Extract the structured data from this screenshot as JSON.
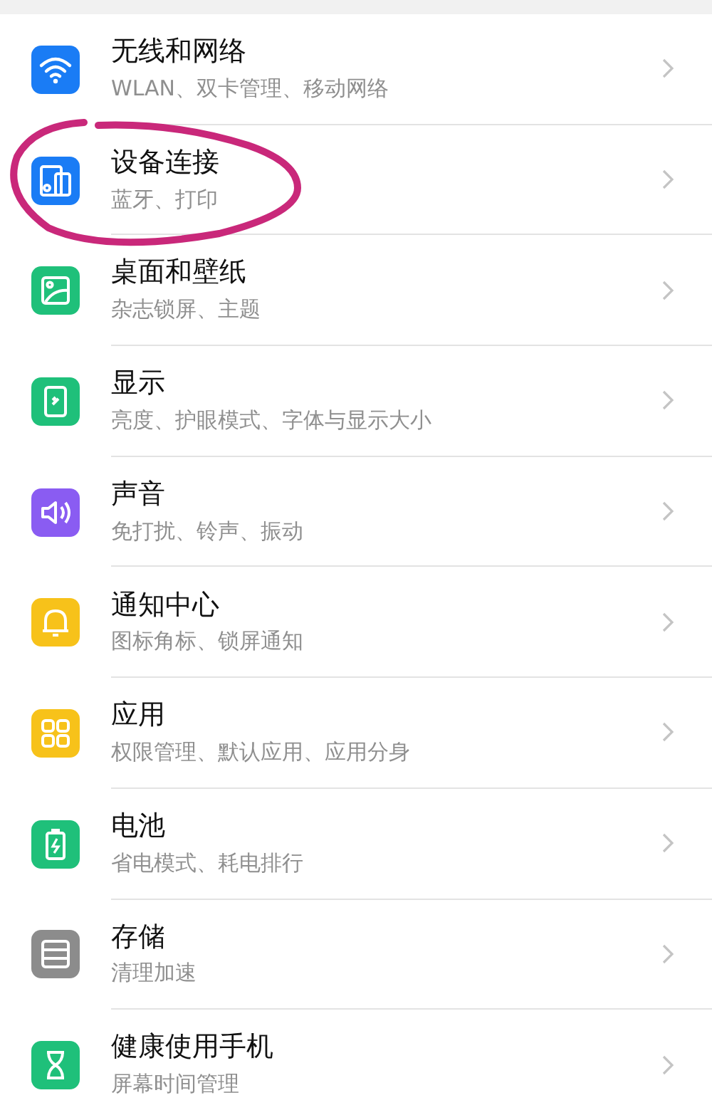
{
  "settings": [
    {
      "title": "无线和网络",
      "subtitle": "WLAN、双卡管理、移动网络",
      "kind": "wifi",
      "color": "#1a7cf5",
      "annotated": false
    },
    {
      "title": "设备连接",
      "subtitle": "蓝牙、打印",
      "kind": "devices",
      "color": "#1a7cf5",
      "annotated": true
    },
    {
      "title": "桌面和壁纸",
      "subtitle": "杂志锁屏、主题",
      "kind": "image",
      "color": "#1fc07a",
      "annotated": false
    },
    {
      "title": "显示",
      "subtitle": "亮度、护眼模式、字体与显示大小",
      "kind": "display",
      "color": "#1fc07a",
      "annotated": false
    },
    {
      "title": "声音",
      "subtitle": "免打扰、铃声、振动",
      "kind": "sound",
      "color": "#8a5cf2",
      "annotated": false
    },
    {
      "title": "通知中心",
      "subtitle": "图标角标、锁屏通知",
      "kind": "bell",
      "color": "#f7c21a",
      "annotated": false
    },
    {
      "title": "应用",
      "subtitle": "权限管理、默认应用、应用分身",
      "kind": "apps",
      "color": "#f7c21a",
      "annotated": false
    },
    {
      "title": "电池",
      "subtitle": "省电模式、耗电排行",
      "kind": "battery",
      "color": "#1fc07a",
      "annotated": false
    },
    {
      "title": "存储",
      "subtitle": "清理加速",
      "kind": "storage",
      "color": "#8c8c8c",
      "annotated": false
    },
    {
      "title": "健康使用手机",
      "subtitle": "屏幕时间管理",
      "kind": "hourglass",
      "color": "#1fc07a",
      "annotated": false
    }
  ]
}
